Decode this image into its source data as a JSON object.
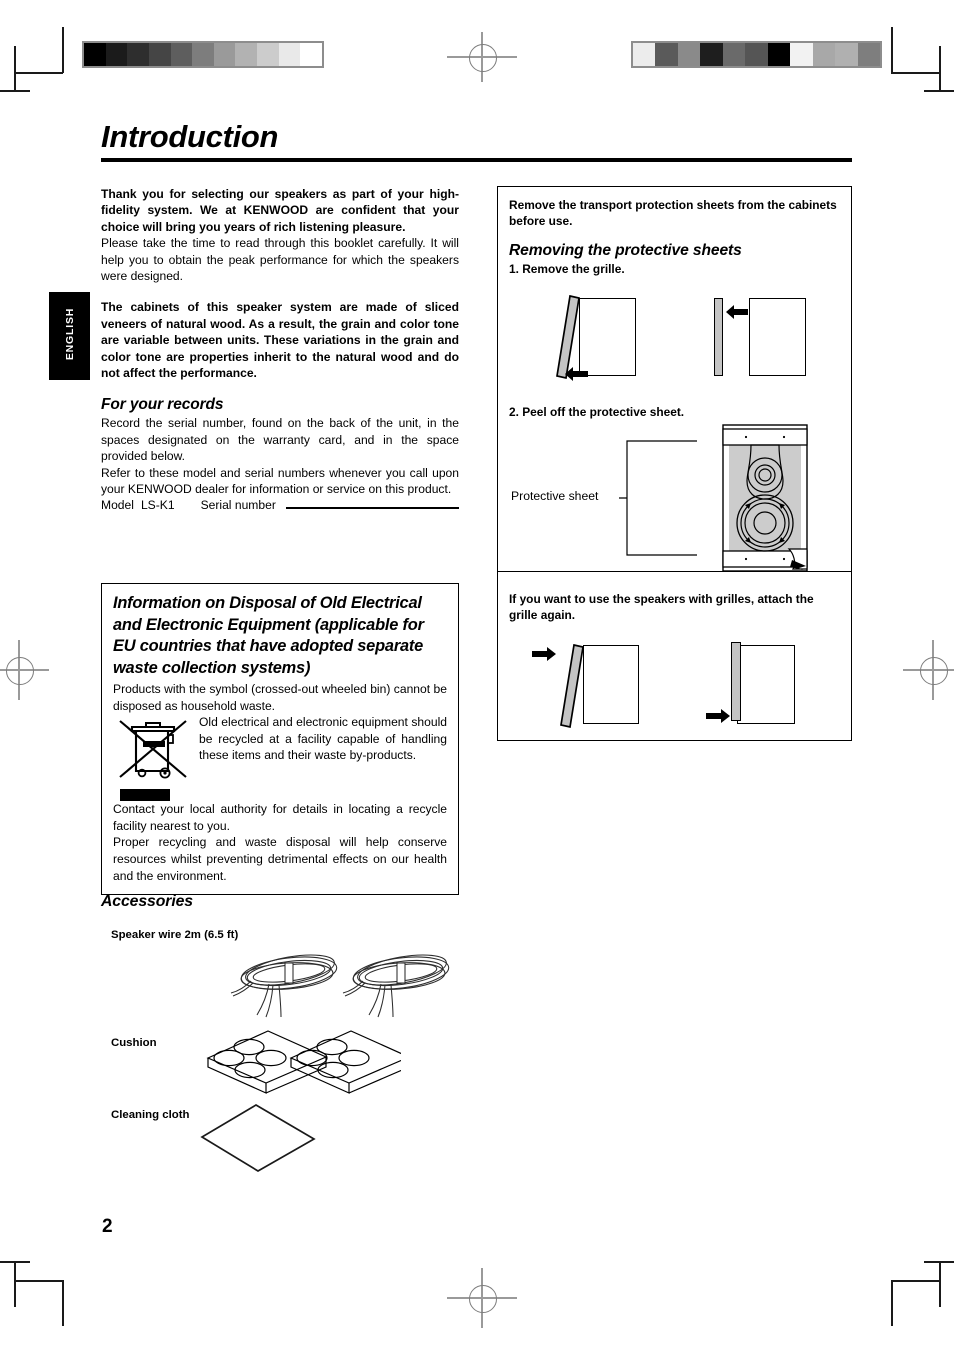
{
  "page": {
    "title": "Introduction",
    "number": "2",
    "language_tab": "ENGLISH"
  },
  "left_column": {
    "intro_bold": "Thank you for selecting our speakers as part of your high-fidelity system. We at KENWOOD are confident that your choice will bring you years of rich listening pleasure.",
    "intro_body": "Please take the time to read through this booklet carefully. It will help you to obtain the peak performance for which the speakers were designed.",
    "cabinet_notice": "The cabinets of this speaker system are made of sliced veneers of natural wood. As a result, the grain and color tone are variable between units. These variations in the grain and color tone are properties inherit to the natural wood and do not affect the performance.",
    "records": {
      "heading": "For your records",
      "para1": "Record the serial number, found on the back of the unit, in the spaces designated on the warranty card, and in the space provided below.",
      "para2": "Refer to these model and serial numbers whenever you call upon your KENWOOD dealer for information or service on this product.",
      "model_label": "Model",
      "model_value": "LS-K1",
      "serial_label": "Serial number",
      "serial_value": ""
    },
    "disposal": {
      "heading": "Information on Disposal of Old Electrical and Electronic Equipment (applicable for EU countries that have adopted separate waste collection systems)",
      "para1": "Products with the symbol (crossed-out wheeled bin) cannot be disposed as household waste.",
      "para2": "Old electrical and electronic equipment should be recycled at a facility capable of handling these items and their waste by-products.",
      "para3": "Contact your local authority for details in locating a recycle facility nearest to you.",
      "para4": "Proper recycling and waste disposal will help conserve resources whilst preventing detrimental effects on our health and the environment."
    },
    "accessories": {
      "heading": "Accessories",
      "items": [
        {
          "label": "Speaker wire 2m (6.5 ft)",
          "icon": "speaker-wire-coil-icon",
          "quantity": 2
        },
        {
          "label": "Cushion",
          "icon": "cushion-pad-icon",
          "quantity": 2
        },
        {
          "label": "Cleaning cloth",
          "icon": "cleaning-cloth-icon",
          "quantity": 1
        }
      ]
    }
  },
  "right_column": {
    "notice": "Remove the transport protection sheets from the cabinets before use.",
    "heading": "Removing the protective sheets",
    "step1": "1. Remove the grille.",
    "step2": "2. Peel off the protective sheet.",
    "callout": "Protective sheet",
    "reattach_note": "If you want to use the speakers with grilles, attach the grille again."
  },
  "print_marks": {
    "grayscale_strip_left": [
      "#000000",
      "#1b1b1b",
      "#2e2e2e",
      "#454545",
      "#5e5e5e",
      "#7d7d7d",
      "#9a9a9a",
      "#b2b2b2",
      "#cccccc",
      "#e9e9e9",
      "#ffffff"
    ],
    "grayscale_strip_right": [
      "#ececec",
      "#5a5a5a",
      "#8a8a8a",
      "#1e1e1e",
      "#6a6a6a",
      "#555555",
      "#000000",
      "#f2f2f2",
      "#a8a8a8",
      "#b0b0b0",
      "#7e7e7e"
    ],
    "registration_target_icon": "registration-crosshair-icon",
    "crop_mark_icon": "crop-mark-icon"
  },
  "colors": {
    "ink": "#000000",
    "grille_gray": "#c4c4c4",
    "speaker_body_gray": "#cccccc"
  }
}
